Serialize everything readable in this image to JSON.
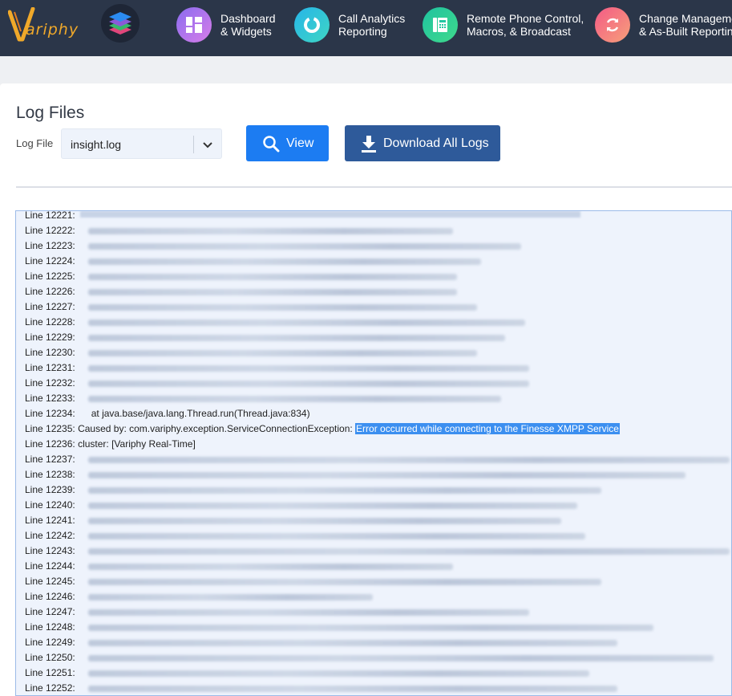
{
  "brand": {
    "logo_text": "ariphy",
    "logo_accent": "#f0a92a"
  },
  "nav": {
    "items": [
      {
        "line1": "Dashboard",
        "line2": "& Widgets",
        "icon": "dashboard-icon",
        "color": "#b06cf0"
      },
      {
        "line1": "Call Analytics",
        "line2": "Reporting",
        "icon": "analytics-icon",
        "color": "#2cc4d6"
      },
      {
        "line1": "Remote Phone Control,",
        "line2": "Macros, & Broadcast",
        "icon": "phone-icon",
        "color": "#23c7a2"
      },
      {
        "line1": "Change Management",
        "line2": "& As-Built Reporting",
        "icon": "refresh-icon",
        "color": "#f35d8a"
      }
    ]
  },
  "page": {
    "title": "Log Files",
    "log_file_label": "Log File",
    "selected_file": "insight.log",
    "view_label": "View",
    "download_label": "Download All Logs"
  },
  "log": {
    "lines": [
      {
        "label": "Line 12221:",
        "text": "",
        "blur": 0
      },
      {
        "label": "Line 12222:",
        "text": "",
        "blur": 455
      },
      {
        "label": "Line 12223:",
        "text": "",
        "blur": 540
      },
      {
        "label": "Line 12224:",
        "text": "",
        "blur": 490
      },
      {
        "label": "Line 12225:",
        "text": "",
        "blur": 460
      },
      {
        "label": "Line 12226:",
        "text": "",
        "blur": 460
      },
      {
        "label": "Line 12227:",
        "text": "",
        "blur": 485
      },
      {
        "label": "Line 12228:",
        "text": "",
        "blur": 545
      },
      {
        "label": "Line 12229:",
        "text": "",
        "blur": 520
      },
      {
        "label": "Line 12230:",
        "text": "",
        "blur": 485
      },
      {
        "label": "Line 12231:",
        "text": "",
        "blur": 550
      },
      {
        "label": "Line 12232:",
        "text": "",
        "blur": 550
      },
      {
        "label": "Line 12233:",
        "text": "",
        "blur": 515
      },
      {
        "label": "Line 12234:",
        "text": "at java.base/java.lang.Thread.run(Thread.java:834)",
        "blur": 0
      },
      {
        "label": "Line 12235:",
        "text": "Caused by: com.variphy.exception.ServiceConnectionException: ",
        "highlight": "Error occurred while connecting to the Finesse XMPP Service",
        "blur": 0
      },
      {
        "label": "Line 12236:",
        "text": "cluster: [Variphy Real-Time]",
        "blur": 0
      },
      {
        "label": "Line 12237:",
        "text": "",
        "blur": 800
      },
      {
        "label": "Line 12238:",
        "text": "",
        "blur": 745
      },
      {
        "label": "Line 12239:",
        "text": "",
        "blur": 640
      },
      {
        "label": "Line 12240:",
        "text": "",
        "blur": 610
      },
      {
        "label": "Line 12241:",
        "text": "",
        "blur": 590
      },
      {
        "label": "Line 12242:",
        "text": "",
        "blur": 620
      },
      {
        "label": "Line 12243:",
        "text": "",
        "blur": 800
      },
      {
        "label": "Line 12244:",
        "text": "",
        "blur": 455
      },
      {
        "label": "Line 12245:",
        "text": "",
        "blur": 640
      },
      {
        "label": "Line 12246:",
        "text": "",
        "blur": 355
      },
      {
        "label": "Line 12247:",
        "text": "",
        "blur": 550
      },
      {
        "label": "Line 12248:",
        "text": "",
        "blur": 705
      },
      {
        "label": "Line 12249:",
        "text": "",
        "blur": 660
      },
      {
        "label": "Line 12250:",
        "text": "",
        "blur": 780
      },
      {
        "label": "Line 12251:",
        "text": "",
        "blur": 625
      },
      {
        "label": "Line 12252:",
        "text": "",
        "blur": 660
      }
    ]
  }
}
